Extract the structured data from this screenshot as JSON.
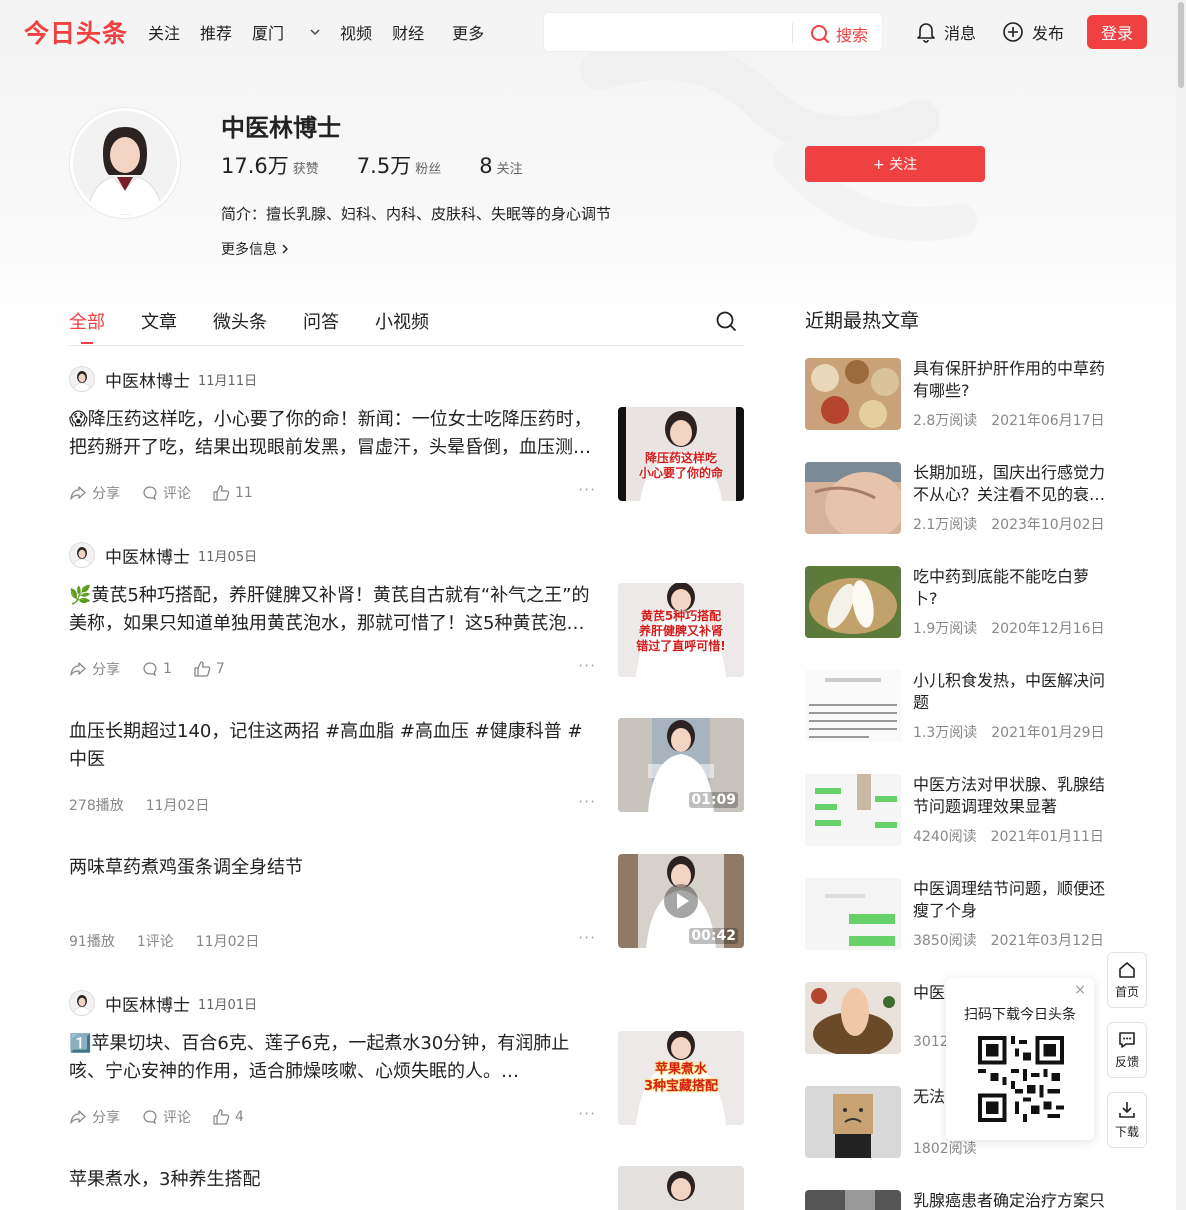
{
  "brand": {
    "logo": "今日头条",
    "accent": "#f04142"
  },
  "nav": {
    "links": [
      "关注",
      "推荐",
      "厦门",
      "视频",
      "财经",
      "更多"
    ],
    "search_placeholder": "",
    "search_label": "搜索",
    "messages_label": "消息",
    "publish_label": "发布",
    "login_label": "登录"
  },
  "profile": {
    "name": "中医林博士",
    "likes_num": "17.6万",
    "likes_label": "获赞",
    "fans_num": "7.5万",
    "fans_label": "粉丝",
    "following_num": "8",
    "following_label": "关注",
    "intro": "简介：擅长乳腺、妇科、内科、皮肤科、失眠等的身心调节",
    "more_info": "更多信息",
    "follow_label": "+ 关注"
  },
  "tabs": [
    "全部",
    "文章",
    "微头条",
    "问答",
    "小视频"
  ],
  "feed": [
    {
      "author": "中医林博士",
      "date": "11月11日",
      "title": "😱降压药这样吃，小心要了你的命！新闻：一位女士吃降压药时，把药掰开了吃，结果出现眼前发黑，冒虚汗，头晕昏倒，血压测…",
      "share": "分享",
      "comment": "评论",
      "likes": "11",
      "thumb_text": "降压药这样吃\n小心要了你的命"
    },
    {
      "author": "中医林博士",
      "date": "11月05日",
      "title": "🌿黄芪5种巧搭配，养肝健脾又补肾！黄芪自古就有“补气之王”的美称，如果只知道单独用黄芪泡水，那就可惜了！这5种黄芪泡…",
      "share": "分享",
      "comment": "1",
      "likes": "7",
      "thumb_text": "黄芪5种巧搭配\n养肝健脾又补肾\n错过了直呼可惜!"
    },
    {
      "title": "血压长期超过140，记住这两招 #高血脂 #高血压 #健康科普 #中医",
      "plays": "278播放",
      "date": "11月02日",
      "duration": "01:09"
    },
    {
      "title": "两味草药煮鸡蛋条调全身结节",
      "plays": "91播放",
      "comments": "1评论",
      "date": "11月02日",
      "duration": "00:42"
    },
    {
      "author": "中医林博士",
      "date": "11月01日",
      "title": "1️⃣苹果切块、百合6克、莲子6克，一起煮水30分钟，有润肺止咳、宁心安神的作用，适合肺燥咳嗽、心烦失眠的人。…",
      "share": "分享",
      "comment": "评论",
      "likes": "4",
      "thumb_text": "苹果煮水\n3种宝藏搭配"
    },
    {
      "title": "苹果煮水，3种养生搭配"
    }
  ],
  "hot": {
    "title": "近期最热文章",
    "items": [
      {
        "title": "具有保肝护肝作用的中草药有哪些?",
        "reads": "2.8万阅读",
        "date": "2021年06月17日"
      },
      {
        "title": "长期加班，国庆出行感觉力不从心？关注看不见的衰…",
        "reads": "2.1万阅读",
        "date": "2023年10月02日"
      },
      {
        "title": "吃中药到底能不能吃白萝卜?",
        "reads": "1.9万阅读",
        "date": "2020年12月16日"
      },
      {
        "title": "小儿积食发热，中医解决问题",
        "reads": "1.3万阅读",
        "date": "2021年01月29日"
      },
      {
        "title": "中医方法对甲状腺、乳腺结节问题调理效果显著",
        "reads": "4240阅读",
        "date": "2021年01月11日"
      },
      {
        "title": "中医调理结节问题，顺便还瘦了个身",
        "reads": "3850阅读",
        "date": "2021年03月12日"
      },
      {
        "title": "中医…效，…用",
        "reads": "3012",
        "date": ""
      },
      {
        "title": "无法…脾经",
        "reads": "1802阅读",
        "date": ""
      },
      {
        "title": "乳腺癌患者确定治疗方案只",
        "reads": "",
        "date": ""
      }
    ]
  },
  "qr": {
    "text": "扫码下载今日头条",
    "close": "×"
  },
  "side": {
    "home": "首页",
    "feedback": "反馈",
    "download": "下载"
  }
}
